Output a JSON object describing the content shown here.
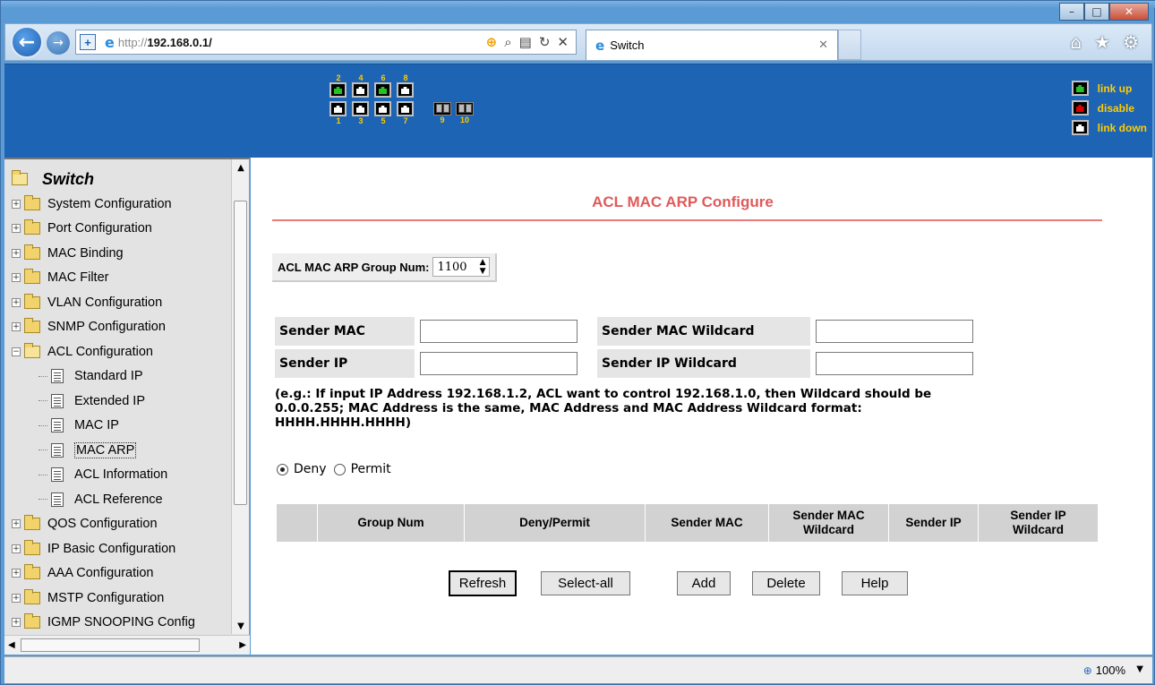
{
  "browser": {
    "url_prefix": "http://",
    "url_host": "192.168.0.1/",
    "tab_title": "Switch",
    "zoom": "100%",
    "window_controls": [
      "–",
      "□",
      "✕"
    ]
  },
  "header": {
    "ports_top": [
      {
        "num": "2",
        "status": "up"
      },
      {
        "num": "4",
        "status": "down"
      },
      {
        "num": "6",
        "status": "up"
      },
      {
        "num": "8",
        "status": "down"
      }
    ],
    "ports_bottom": [
      {
        "num": "1",
        "status": "down"
      },
      {
        "num": "3",
        "status": "down"
      },
      {
        "num": "5",
        "status": "down"
      },
      {
        "num": "7",
        "status": "down"
      }
    ],
    "sfp_ports": [
      "9",
      "10"
    ],
    "legend": [
      {
        "label": "link up",
        "status": "up"
      },
      {
        "label": "disable",
        "status": "dis"
      },
      {
        "label": "link down",
        "status": "down"
      }
    ]
  },
  "sidebar": {
    "root": "Switch",
    "items_before": [
      "System Configuration",
      "Port Configuration",
      "MAC Binding",
      "MAC Filter",
      "VLAN Configuration",
      "SNMP Configuration"
    ],
    "open_folder": "ACL Configuration",
    "children": [
      "Standard IP",
      "Extended IP",
      "MAC IP",
      "MAC ARP",
      "ACL Information",
      "ACL Reference"
    ],
    "selected_child": "MAC ARP",
    "items_after": [
      "QOS Configuration",
      "IP Basic Configuration",
      "AAA Configuration",
      "MSTP Configuration",
      "IGMP SNOOPING Config"
    ]
  },
  "main": {
    "title": "ACL MAC ARP Configure",
    "group_label": "ACL MAC ARP Group Num:",
    "group_value": "1100",
    "sender_mac_label": "Sender MAC",
    "sender_mac_wildcard_label": "Sender MAC Wildcard",
    "sender_ip_label": "Sender IP",
    "sender_ip_wildcard_label": "Sender IP Wildcard",
    "note": "(e.g.: If input IP Address 192.168.1.2, ACL want to control 192.168.1.0, then Wildcard should be 0.0.0.255; MAC Address is the same, MAC Address and MAC Address Wildcard format: HHHH.HHHH.HHHH)",
    "radio_deny": "Deny",
    "radio_permit": "Permit",
    "selected_action": "Deny",
    "table_headers": [
      "",
      "Group Num",
      "Deny/Permit",
      "Sender MAC",
      "Sender MAC Wildcard",
      "Sender IP",
      "Sender IP Wildcard"
    ],
    "buttons": {
      "refresh": "Refresh",
      "select_all": "Select-all",
      "add": "Add",
      "delete": "Delete",
      "help": "Help"
    }
  },
  "colors": {
    "header_bg": "#1e64b4",
    "title_red": "#e05a5a",
    "port_label_yellow": "#ffcc00",
    "link_up_green": "#22c322",
    "disable_red": "#e00000"
  }
}
